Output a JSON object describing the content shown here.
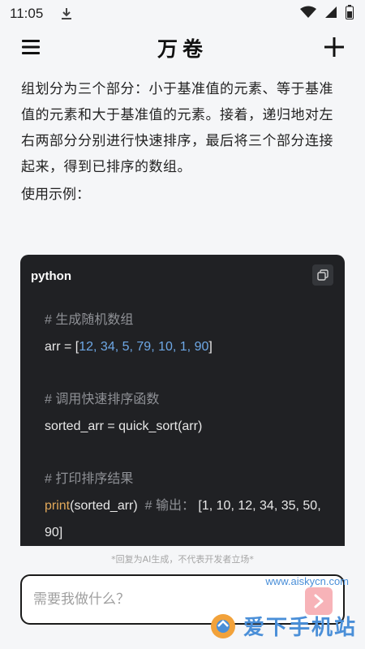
{
  "status_bar": {
    "time": "11:05",
    "icons": [
      "download-icon",
      "wifi-icon",
      "signal-icon",
      "battery-icon"
    ]
  },
  "app_bar": {
    "title": "万卷",
    "menu_icon": "menu-icon",
    "add_icon": "plus-icon"
  },
  "answer": {
    "paragraph": "组划分为三个部分：小于基准值的元素、等于基准值的元素和大于基准值的元素。接着，递归地对左右两部分分别进行快速排序，最后将三个部分连接起来，得到已排序的数组。",
    "example_label": "使用示例："
  },
  "code_block": {
    "language": "python",
    "copy_icon": "copy-icon",
    "lines": {
      "comment1": "# 生成随机数组",
      "arr_prefix": "arr = [",
      "arr_values": "12, 34, 5, 79, 10, 1, 90",
      "arr_suffix": "]",
      "comment2": "# 调用快速排序函数",
      "sorted_line": "sorted_arr = quick_sort(arr)",
      "comment3": "# 打印排序结果",
      "print_fn": "print",
      "print_args": "(sorted_arr)",
      "print_comment": "# 输出：",
      "print_output": "[1, 10, 12, 34, 35, 50, 90]"
    }
  },
  "footer": {
    "disclaimer": "*回复为AI生成，不代表开发者立场*",
    "input_placeholder": "需要我做什么？",
    "send_icon": "chevron-right-icon"
  },
  "watermark": {
    "text": "爱下手机站",
    "url": "www.aiskycn.com"
  },
  "colors": {
    "background": "#f5f6f8",
    "code_bg": "#202124",
    "send_button": "#f7b3b8",
    "number": "#6ea8e6",
    "function": "#e3a95a",
    "comment": "#8f9196"
  }
}
